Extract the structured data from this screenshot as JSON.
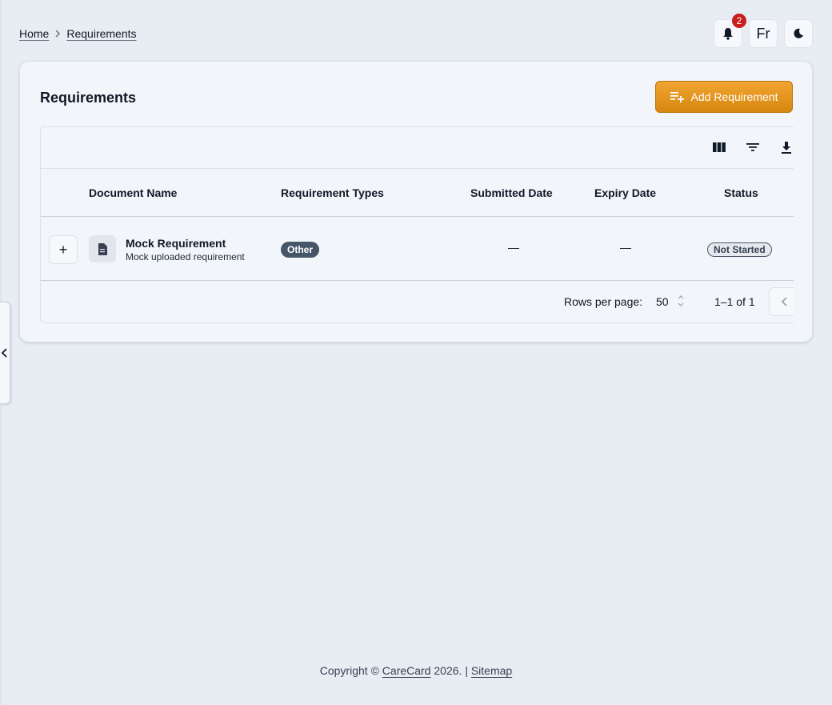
{
  "breadcrumb": {
    "home": "Home",
    "current": "Requirements"
  },
  "header": {
    "notification_count": "2",
    "language_label": "Fr"
  },
  "page": {
    "title": "Requirements",
    "add_button_label": "Add Requirement"
  },
  "table": {
    "columns": [
      "Document Name",
      "Requirement Types",
      "Submitted Date",
      "Expiry Date",
      "Status"
    ],
    "rows": [
      {
        "name": "Mock Requirement",
        "subtitle": "Mock uploaded requirement",
        "type": "Other",
        "submitted": "—",
        "expiry": "—",
        "status": "Not Started"
      }
    ],
    "pagination": {
      "rows_per_page_label": "Rows per page:",
      "rows_per_page": "50",
      "range": "1–1 of 1"
    }
  },
  "footer": {
    "copyright_prefix": "Copyright ©",
    "brand": "CareCard",
    "year_text": "2026. |",
    "sitemap": "Sitemap"
  },
  "colors": {
    "accent": "#e29722",
    "badge": "#c81e1e",
    "chip_other": "#475569"
  }
}
